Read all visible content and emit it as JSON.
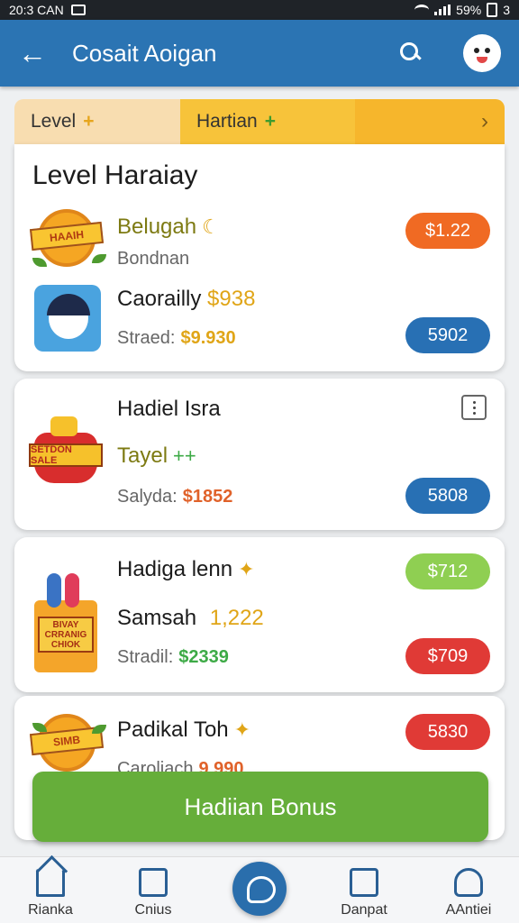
{
  "status": {
    "time": "20:3 CAN",
    "battery": "59%",
    "carrier": "3"
  },
  "appbar": {
    "title": "Cosait Aoigan"
  },
  "tabs": [
    {
      "label": "Level",
      "icon": "plus-icon"
    },
    {
      "label": "Hartian",
      "icon": "plus-icon"
    },
    {
      "label": "›",
      "icon": "chevron-right-icon"
    }
  ],
  "card1": {
    "title": "Level Haraiay",
    "row1": {
      "title": "Belugah",
      "subtitle": "Bondnan",
      "pill": "$1.22"
    },
    "row2": {
      "title": "Caorailly",
      "title_amount": "$938",
      "sub_label": "Straed:",
      "sub_amount": "$9.930",
      "pill": "5902"
    },
    "badge1_text": "HAAIH"
  },
  "card2": {
    "title": "Hadiel Isra",
    "row": "Tayel",
    "sub_label": "Salyda:",
    "sub_amount": "$1852",
    "pill": "5808",
    "badge_text": "SETDON SALE"
  },
  "card3": {
    "title": "Hadiga lenn",
    "row": "Samsah",
    "row_amount": "1,222",
    "sub_label": "Stradil:",
    "sub_amount": "$2339",
    "pill_top": "$712",
    "pill_bottom": "$709",
    "badge_text": "BIVAY CRRANIG CHIOK"
  },
  "card4": {
    "title": "Padikal Toh",
    "sub_label": "Caroliach",
    "sub_amount": "9,990",
    "pill": "5830",
    "badge_text": "SIMB"
  },
  "bonus_button": "Hadiian Bonus",
  "bottom_nav": [
    {
      "label": "Rianka"
    },
    {
      "label": "Cnius"
    },
    {
      "label": "Danpat"
    },
    {
      "label": "AAntiei"
    }
  ]
}
